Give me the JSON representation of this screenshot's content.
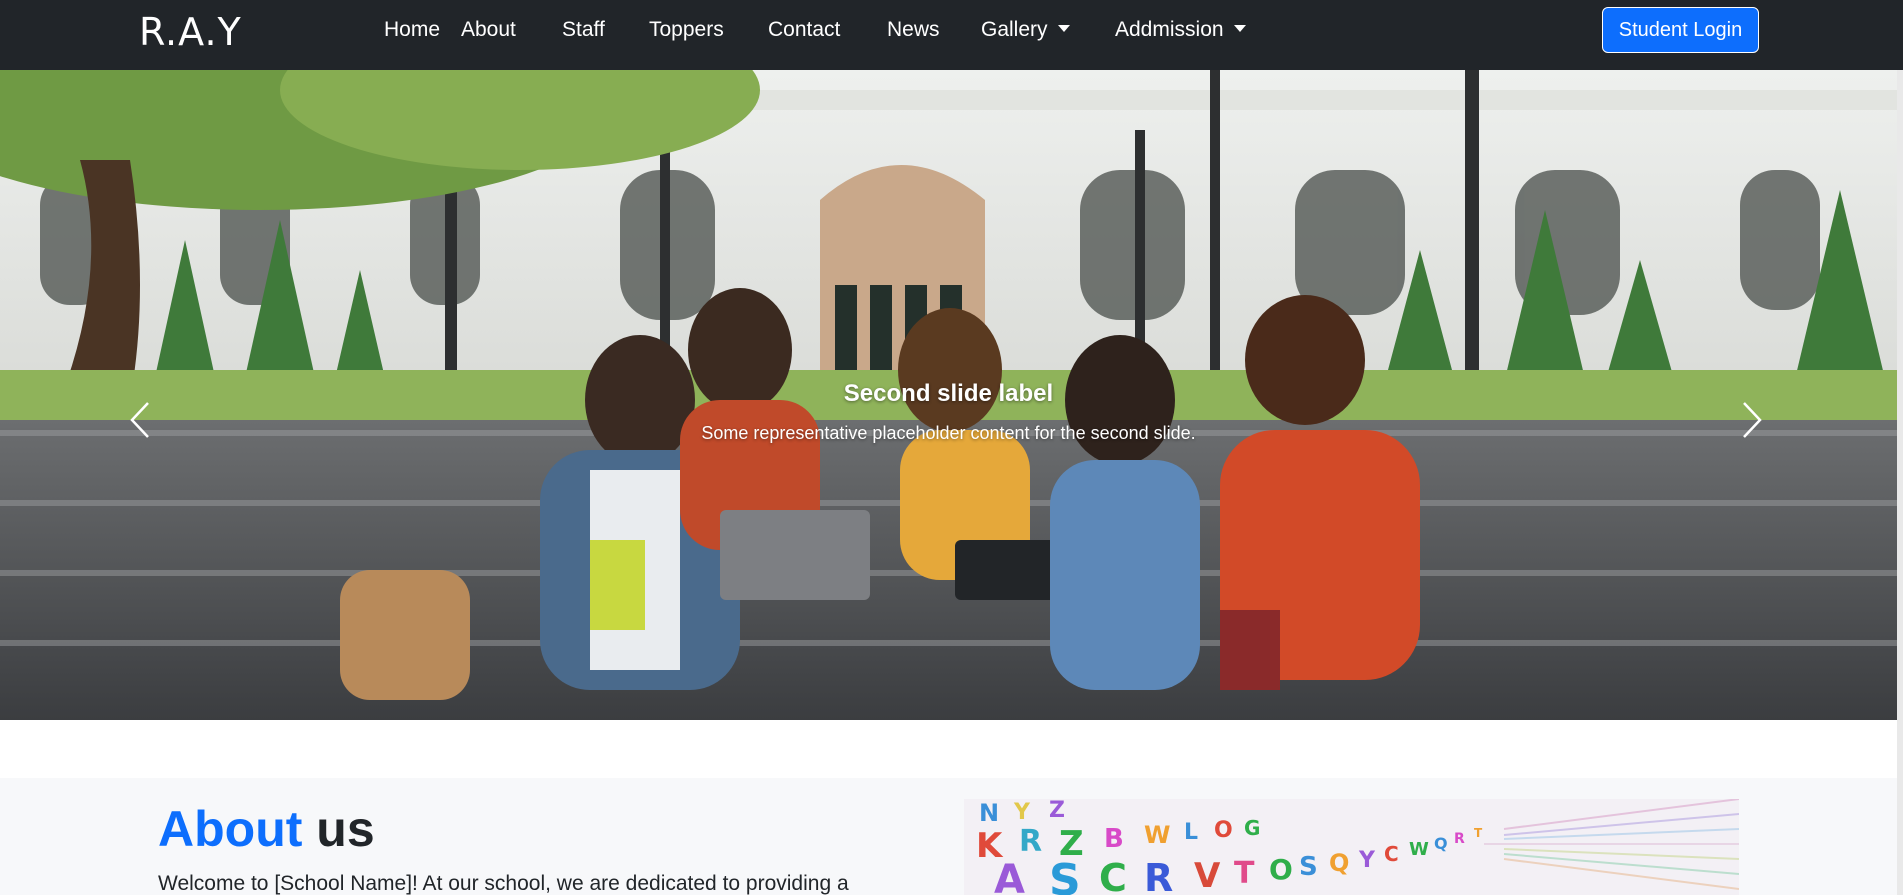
{
  "brand": "R.A.Y",
  "nav": {
    "home": "Home",
    "about": "About",
    "staff": "Staff",
    "toppers": "Toppers",
    "contact": "Contact",
    "news": "News",
    "gallery": "Gallery",
    "admission": "Addmission"
  },
  "login_label": "Student Login",
  "carousel": {
    "title": "Second slide label",
    "text": "Some representative placeholder content for the second slide."
  },
  "about": {
    "heading_accent": "About",
    "heading_rest": "us",
    "text": "Welcome to [School Name]! At our school, we are dedicated to providing a"
  },
  "colors": {
    "navbar": "#212529",
    "accent": "#0d6efd",
    "section_bg": "#f7f8fa"
  },
  "icons": {
    "prev": "chevron-left-icon",
    "next": "chevron-right-icon",
    "dropdown": "caret-down-icon"
  }
}
